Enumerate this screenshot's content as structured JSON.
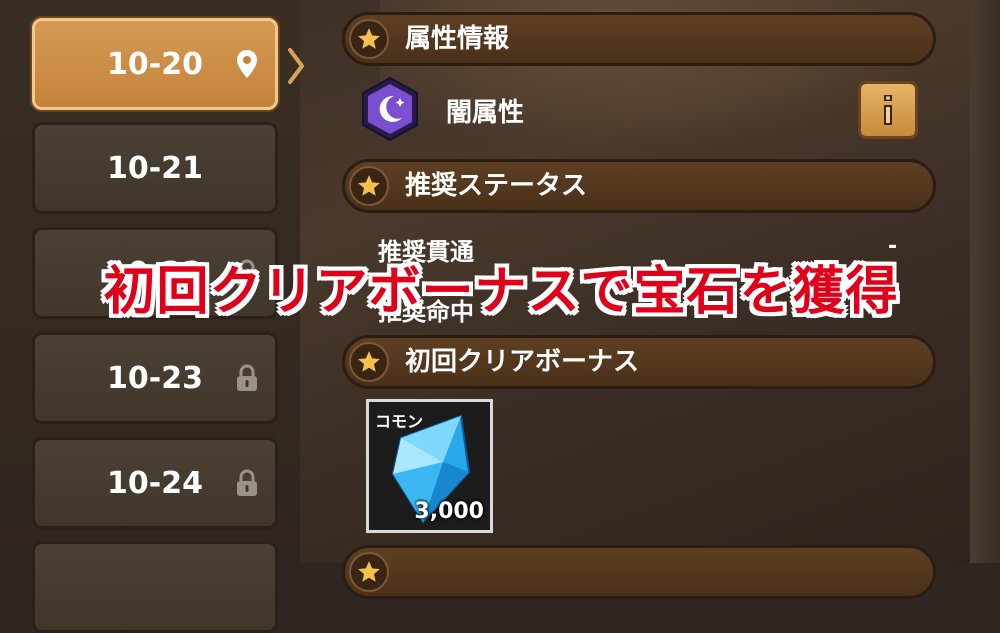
{
  "stages": [
    {
      "label": "10-20",
      "state": "selected",
      "icon": "location-pin-icon"
    },
    {
      "label": "10-21",
      "state": "unlocked",
      "icon": ""
    },
    {
      "label": "10-22",
      "state": "locked",
      "icon": "padlock-icon"
    },
    {
      "label": "10-23",
      "state": "locked",
      "icon": "padlock-icon"
    },
    {
      "label": "10-24",
      "state": "locked",
      "icon": "padlock-icon"
    }
  ],
  "sections": {
    "attribute": {
      "title": "属性情報",
      "icon": "star-icon"
    },
    "recommended": {
      "title": "推奨ステータス",
      "icon": "star-icon"
    },
    "first_clear": {
      "title": "初回クリアボーナス",
      "icon": "star-icon"
    }
  },
  "attribute": {
    "name": "闇属性",
    "icon": "crescent-moon-icon",
    "info_icon": "info-icon"
  },
  "recommended": {
    "penetration_label": "推奨貫通",
    "penetration_value": "-",
    "accuracy_label": "推奨命中"
  },
  "reward": {
    "rarity": "コモン",
    "item_icon": "blue-gem-icon",
    "quantity": "3,000"
  },
  "caption": "初回クリアボーナスで宝石を獲得",
  "colors": {
    "selected_stage": "#d59a52",
    "section_header": "#5e3f22",
    "caption_text": "#e0001a",
    "caption_outline": "#ffffff"
  }
}
